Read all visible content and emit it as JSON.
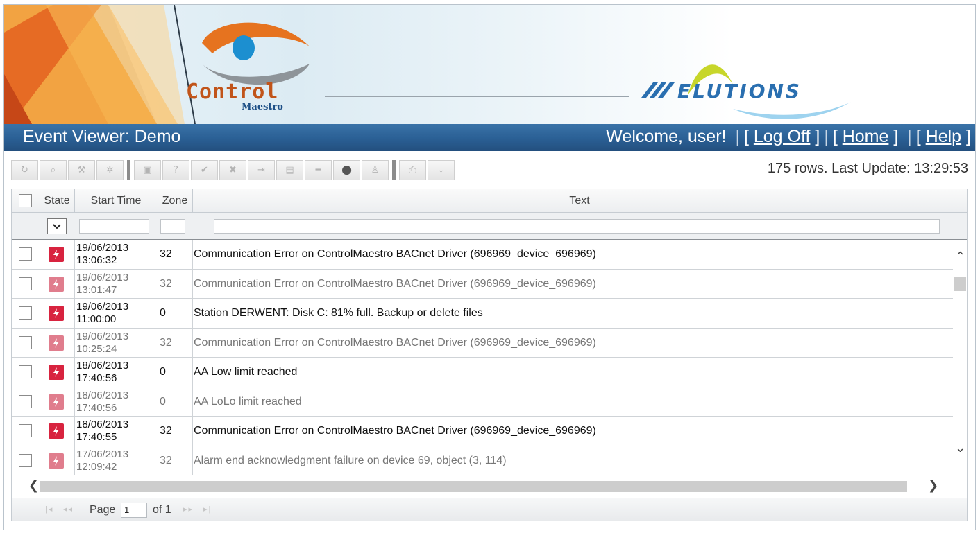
{
  "header": {
    "logo_main": "Control",
    "logo_sub": "Maestro",
    "partner_logo": "ELUTIONS"
  },
  "titlebar": {
    "title": "Event Viewer: Demo",
    "welcome": "Welcome, user!",
    "links": [
      "Log Off",
      "Home",
      "Help"
    ]
  },
  "toolbar": {
    "buttons": [
      "refresh-icon",
      "search-icon",
      "wrench-icon",
      "gear-icon",
      "image-icon",
      "help-icon",
      "check-icon",
      "close-icon",
      "pin-icon",
      "comment-icon",
      "minus-icon",
      "stop-icon",
      "user-icon",
      "print-icon",
      "download-icon"
    ],
    "status": "175 rows.  Last Update: 13:29:53"
  },
  "grid": {
    "columns": [
      "State",
      "Start Time",
      "Zone",
      "Text"
    ],
    "rows": [
      {
        "date": "19/06/2013",
        "time": "13:06:32",
        "zone": "32",
        "text": "Communication Error on ControlMaestro BACnet Driver (696969_device_696969)",
        "dim": false
      },
      {
        "date": "19/06/2013",
        "time": "13:01:47",
        "zone": "32",
        "text": "Communication Error on ControlMaestro BACnet Driver (696969_device_696969)",
        "dim": true
      },
      {
        "date": "19/06/2013",
        "time": "11:00:00",
        "zone": "0",
        "text": "Station DERWENT: Disk C: 81% full. Backup or delete files",
        "dim": false
      },
      {
        "date": "19/06/2013",
        "time": "10:25:24",
        "zone": "32",
        "text": "Communication Error on ControlMaestro BACnet Driver (696969_device_696969)",
        "dim": true
      },
      {
        "date": "18/06/2013",
        "time": "17:40:56",
        "zone": "0",
        "text": "AA Low limit reached",
        "dim": false
      },
      {
        "date": "18/06/2013",
        "time": "17:40:56",
        "zone": "0",
        "text": "AA LoLo limit reached",
        "dim": true
      },
      {
        "date": "18/06/2013",
        "time": "17:40:55",
        "zone": "32",
        "text": "Communication Error on ControlMaestro BACnet Driver (696969_device_696969)",
        "dim": false
      },
      {
        "date": "17/06/2013",
        "time": "12:09:42",
        "zone": "32",
        "text": "Alarm end acknowledgment failure on device 69, object (3, 114)",
        "dim": true
      }
    ]
  },
  "pager": {
    "page_label": "Page",
    "page_value": "1",
    "of_label": "of 1"
  },
  "colors": {
    "titlebar": "#2a5f94",
    "alarm_active": "#d8233f",
    "alarm_dim": "#e07d8d",
    "logo_orange": "#c1541a",
    "partner_blue": "#2a6fb0"
  }
}
